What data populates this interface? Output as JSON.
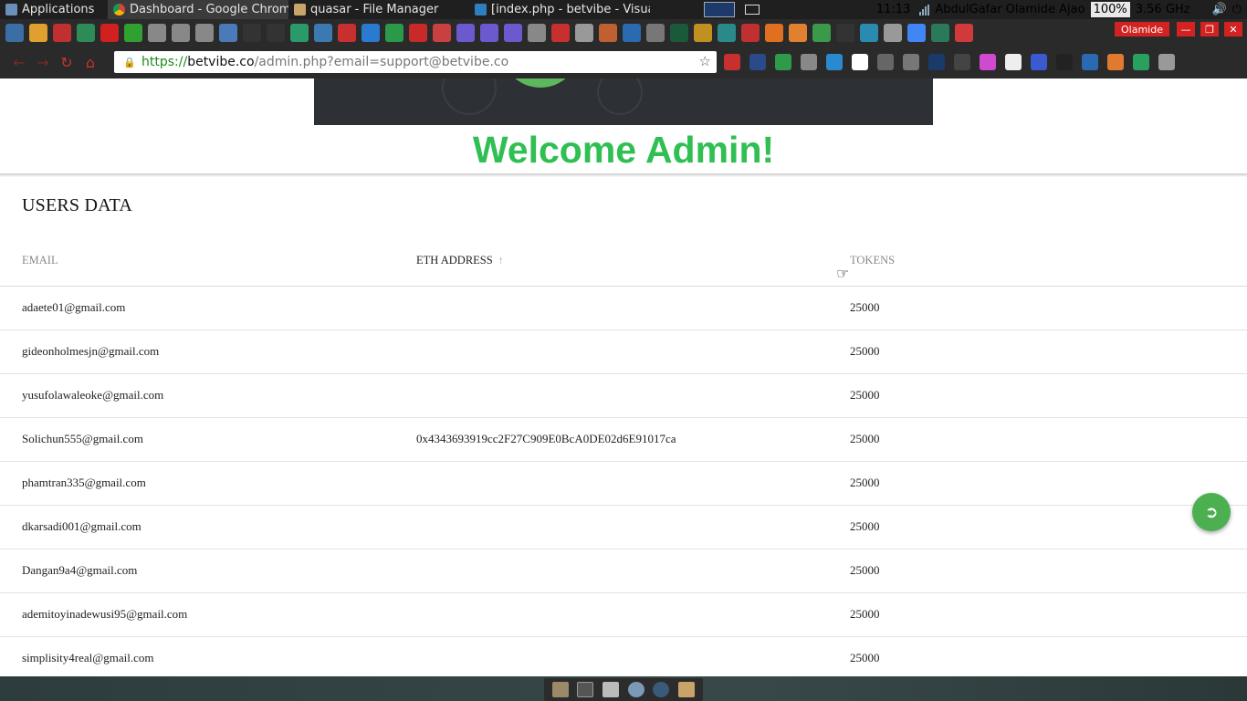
{
  "panel": {
    "apps_label": "Applications",
    "windows": [
      {
        "title": "Dashboard - Google Chrome",
        "icon": "chrome-icon"
      },
      {
        "title": "quasar - File Manager",
        "icon": "folder-icon"
      },
      {
        "title": "[index.php - betvibe - Visua...",
        "icon": "vscode-icon"
      }
    ],
    "clock": "11:13",
    "user": "AbdulGafar Olamide Ajao",
    "battery": "100%",
    "cpu": "3.56 GHz"
  },
  "browser": {
    "profile": "Olamide",
    "url_scheme": "https://",
    "url_host": "betvibe.co",
    "url_path": "/admin.php?email=support@betvibe.co"
  },
  "page": {
    "welcome": "Welcome Admin!",
    "card_title": "USERS DATA",
    "columns": [
      "EMAIL",
      "ETH ADDRESS",
      "TOKENS"
    ],
    "sort_icon": "arrow-up-icon",
    "rows": [
      {
        "email": "adaete01@gmail.com",
        "eth": "",
        "tokens": "25000"
      },
      {
        "email": "gideonholmesjn@gmail.com",
        "eth": "",
        "tokens": "25000"
      },
      {
        "email": "yusufolawaleoke@gmail.com",
        "eth": "",
        "tokens": "25000"
      },
      {
        "email": "Solichun555@gmail.com",
        "eth": "0x4343693919cc2F27C909E0BcA0DE02d6E91017ca",
        "tokens": "25000"
      },
      {
        "email": "phamtran335@gmail.com",
        "eth": "",
        "tokens": "25000"
      },
      {
        "email": "dkarsadi001@gmail.com",
        "eth": "",
        "tokens": "25000"
      },
      {
        "email": "Dangan9a4@gmail.com",
        "eth": "",
        "tokens": "25000"
      },
      {
        "email": "ademitoyinadewusi95@gmail.com",
        "eth": "",
        "tokens": "25000"
      },
      {
        "email": "simplisity4real@gmail.com",
        "eth": "",
        "tokens": "25000"
      }
    ],
    "fab_icon": "logout-icon"
  },
  "colors": {
    "welcome_green": "#2fbf52",
    "fab_green": "#4caf50",
    "profile_red": "#d32222"
  }
}
